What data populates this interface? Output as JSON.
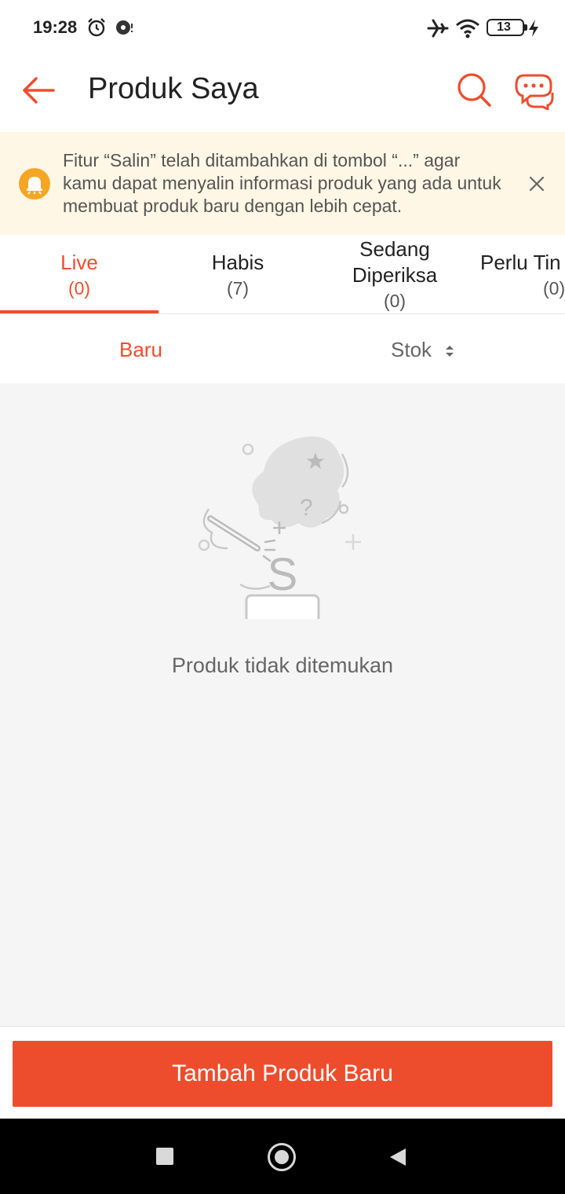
{
  "status_bar": {
    "time": "19:28",
    "battery": "13",
    "icons": [
      "alarm-icon",
      "vpn-icon",
      "airplane-icon",
      "wifi-icon",
      "battery-icon",
      "charging-icon"
    ]
  },
  "header": {
    "title": "Produk Saya",
    "icons": [
      "back-arrow-icon",
      "search-icon",
      "chat-icon"
    ]
  },
  "notice": {
    "text": "Fitur “Salin” telah ditambahkan di tombol “...” agar kamu dapat menyalin informasi produk yang ada untuk membuat produk baru dengan lebih cepat.",
    "icons": [
      "bell-icon",
      "close-icon"
    ]
  },
  "tabs": [
    {
      "label": "Live",
      "count": "(0)",
      "active": true
    },
    {
      "label": "Habis",
      "count": "(7)",
      "active": false
    },
    {
      "label": "Sedang Diperiksa",
      "count": "(0)",
      "active": false
    },
    {
      "label": "Perlu Tin",
      "count": "(0)",
      "active": false
    }
  ],
  "sort": {
    "new_label": "Baru",
    "stock_label": "Stok"
  },
  "empty_state": {
    "message": "Produk tidak ditemukan",
    "illustration_letter": "S"
  },
  "bottom": {
    "add_button_label": "Tambah Produk Baru"
  },
  "colors": {
    "accent": "#ee4d2d",
    "notice_bg": "#fff7e5",
    "notice_icon": "#f5a623",
    "content_bg": "#f5f5f5"
  }
}
